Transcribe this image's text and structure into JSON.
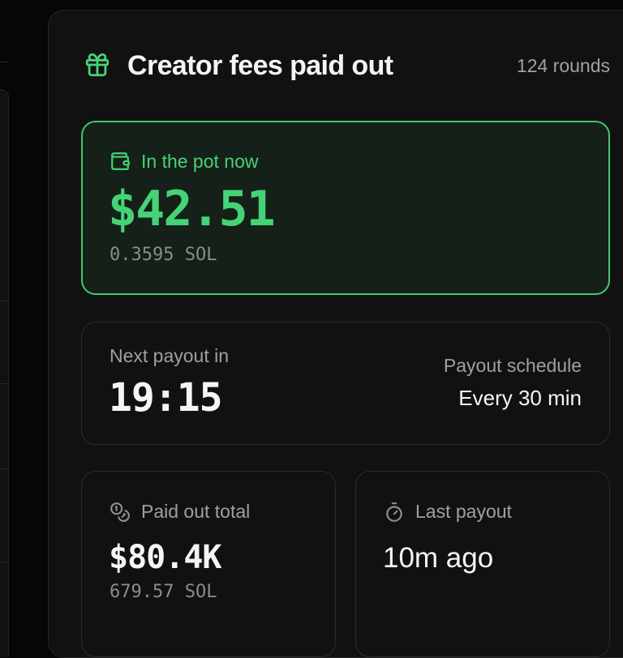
{
  "header": {
    "title": "Creator fees paid out",
    "rounds": "124 rounds",
    "icon": "gift-icon"
  },
  "pot": {
    "label": "In the pot now",
    "amount": "$42.51",
    "sol": "0.3595 SOL",
    "icon": "wallet-icon"
  },
  "next_payout": {
    "label": "Next payout in",
    "countdown": "19:15",
    "schedule_label": "Payout schedule",
    "schedule_value": "Every 30 min"
  },
  "paid_out": {
    "label": "Paid out total",
    "amount": "$80.4K",
    "sol": "679.57 SOL",
    "icon": "coins-icon"
  },
  "last_payout": {
    "label": "Last payout",
    "value": "10m ago",
    "icon": "timer-icon"
  },
  "colors": {
    "accent": "#46d377",
    "background": "#111111",
    "pot_background": "#142018",
    "muted_text": "#a0a0a4"
  }
}
